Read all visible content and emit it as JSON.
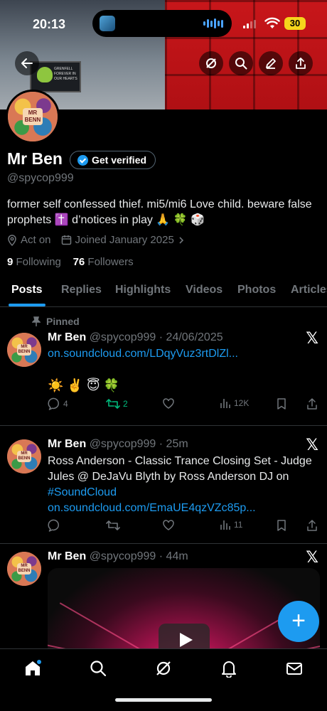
{
  "status_bar": {
    "time": "20:13",
    "battery": "30"
  },
  "banner": {
    "billboard_text": "GRENFELL FOREVER IN OUR HEARTS"
  },
  "profile": {
    "name": "Mr Ben",
    "get_verified": "Get verified",
    "handle": "@spycop999",
    "bio": "former self confessed thief. mi5/mi6 Love child. beware false prophets ✝️ d’notices in play 🙏 🍀 🎲",
    "location": "Act on",
    "joined": "Joined January 2025",
    "following_count": "9",
    "following_label": "Following",
    "followers_count": "76",
    "followers_label": "Followers",
    "avatar_text": "MR BENN"
  },
  "tabs": [
    "Posts",
    "Replies",
    "Highlights",
    "Videos",
    "Photos",
    "Articles"
  ],
  "posts": [
    {
      "pinned_label": "Pinned",
      "name": "Mr Ben",
      "handle_time": "@spycop999 · 24/06/2025",
      "link": "on.soundcloud.com/LDqyVuz3rtDlZl...",
      "emojis": "☀️ ✌️ 😇 🍀",
      "replies": "4",
      "reposts": "2",
      "views": "12K"
    },
    {
      "name": "Mr Ben",
      "handle_time": "@spycop999 · 25m",
      "text": "Ross Anderson - Classic Trance Closing Set - Judge Jules @ DeJaVu Blyth by Ross Anderson DJ on",
      "hashtag": "#SoundCloud",
      "link": "on.soundcloud.com/EmaUE4qzVZc85p...",
      "views": "11"
    },
    {
      "name": "Mr Ben",
      "handle_time": "@spycop999 · 44m"
    }
  ],
  "icons": {
    "back": "arrow-left-icon",
    "grok": "grok-icon",
    "search": "search-icon",
    "edit": "pen-icon",
    "share": "share-icon",
    "x_logo": "x-logo-icon",
    "compose": "plus-icon"
  },
  "colors": {
    "accent": "#1d9bf0",
    "repost_active": "#00ba7c",
    "battery": "#f5d51c"
  }
}
